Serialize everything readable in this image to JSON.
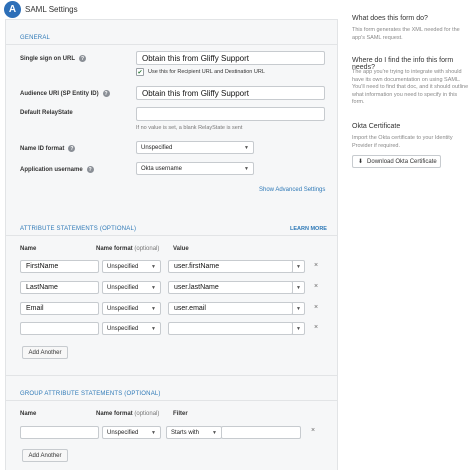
{
  "header": {
    "step": "A",
    "title": "SAML Settings"
  },
  "general": {
    "section_title": "GENERAL",
    "sso_url": {
      "label": "Single sign on URL",
      "value": "Obtain this from Gliffy Support"
    },
    "use_recipient": {
      "label": "Use this for Recipient URL and Destination URL",
      "checked": true
    },
    "audience_uri": {
      "label": "Audience URI (SP Entity ID)",
      "value": "Obtain this from Gliffy Support"
    },
    "relay_state": {
      "label": "Default RelayState",
      "value": "",
      "hint": "If no value is set, a blank RelayState is sent"
    },
    "name_id_format": {
      "label": "Name ID format",
      "value": "Unspecified"
    },
    "app_username": {
      "label": "Application username",
      "value": "Okta username"
    },
    "advanced_link": "Show Advanced Settings"
  },
  "attributes": {
    "section_title": "ATTRIBUTE STATEMENTS (OPTIONAL)",
    "learn_more": "LEARN MORE",
    "col_name": "Name",
    "col_format": "Name format",
    "col_format_opt": "(optional)",
    "col_value": "Value",
    "rows": [
      {
        "name": "FirstName",
        "format": "Unspecified",
        "value": "user.firstName"
      },
      {
        "name": "LastName",
        "format": "Unspecified",
        "value": "user.lastName"
      },
      {
        "name": "Email",
        "format": "Unspecified",
        "value": "user.email"
      },
      {
        "name": "",
        "format": "Unspecified",
        "value": ""
      }
    ],
    "add_button": "Add Another"
  },
  "groups": {
    "section_title": "GROUP ATTRIBUTE STATEMENTS (OPTIONAL)",
    "col_name": "Name",
    "col_format": "Name format",
    "col_format_opt": "(optional)",
    "col_filter": "Filter",
    "rows": [
      {
        "name": "",
        "format": "Unspecified",
        "filter": "Starts with",
        "value": ""
      }
    ],
    "add_button": "Add Another"
  },
  "sidebar": {
    "q1": "What does this form do?",
    "a1": "This form generates the XML needed for the app's SAML request.",
    "q2": "Where do I find the info this form needs?",
    "a2": "The app you're trying to integrate with should have its own documentation on using SAML. You'll need to find that doc, and it should outline what information you need to specify in this form.",
    "cert_title": "Okta Certificate",
    "cert_text": "Import the Okta certificate to your Identity Provider if required.",
    "download_button": "Download Okta Certificate"
  },
  "icons": {
    "caret": "caret-down-icon",
    "help": "help-icon",
    "remove": "close-icon",
    "download": "download-icon",
    "check": "checkmark-icon"
  },
  "colors": {
    "accent": "#2e79b7",
    "badge": "#2d6fb8",
    "panel": "#f6f7f8"
  }
}
